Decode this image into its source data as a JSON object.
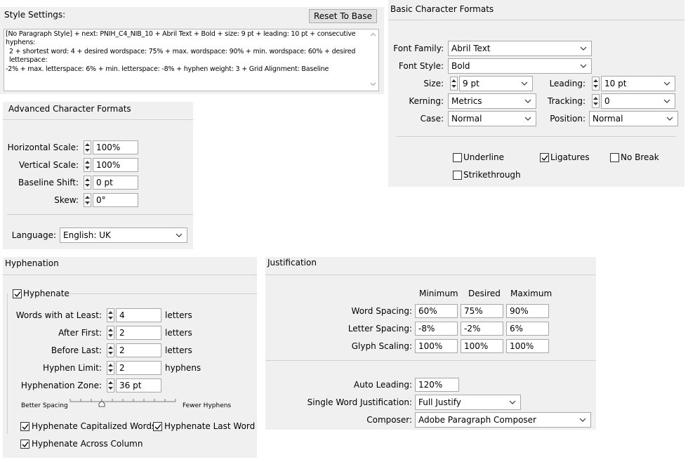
{
  "style_settings": {
    "title": "Style Settings:",
    "reset_button": "Reset To Base",
    "description_lines": [
      "[No Paragraph Style] + next: PNIH_C4_NIB_10 + Abril Text + Bold + size: 9 pt + leading: 10 pt + consecutive hyphens:",
      "2 + shortest word: 4 + desired wordspace: 75% + max. wordspace: 90% + min. wordspace: 60% + desired letterspace:",
      "-2% + max. letterspace: 6% + min. letterspace: -8% + hyphen weight: 3 + Grid Alignment:  Baseline"
    ]
  },
  "basic_character": {
    "title": "Basic Character Formats",
    "font_family": {
      "label": "Font Family:",
      "value": "Abril Text"
    },
    "font_style": {
      "label": "Font Style:",
      "value": "Bold"
    },
    "size": {
      "label": "Size:",
      "value": "9 pt"
    },
    "leading": {
      "label": "Leading:",
      "value": "10 pt"
    },
    "kerning": {
      "label": "Kerning:",
      "value": "Metrics"
    },
    "tracking": {
      "label": "Tracking:",
      "value": "0"
    },
    "case": {
      "label": "Case:",
      "value": "Normal"
    },
    "position": {
      "label": "Position:",
      "value": "Normal"
    },
    "checkboxes": {
      "underline": {
        "label": "Underline",
        "checked": false
      },
      "ligatures": {
        "label": "Ligatures",
        "checked": true
      },
      "no_break": {
        "label": "No Break",
        "checked": false
      },
      "strikethrough": {
        "label": "Strikethrough",
        "checked": false
      }
    }
  },
  "advanced_character": {
    "title": "Advanced Character Formats",
    "horizontal_scale": {
      "label": "Horizontal Scale:",
      "value": "100%"
    },
    "vertical_scale": {
      "label": "Vertical Scale:",
      "value": "100%"
    },
    "baseline_shift": {
      "label": "Baseline Shift:",
      "value": "0 pt"
    },
    "skew": {
      "label": "Skew:",
      "value": "0°"
    },
    "language": {
      "label": "Language:",
      "value": "English: UK"
    }
  },
  "hyphenation": {
    "title": "Hyphenation",
    "hyphenate": {
      "label": "Hyphenate",
      "checked": true
    },
    "words_with_at_least": {
      "label": "Words with at Least:",
      "value": "4",
      "unit": "letters"
    },
    "after_first": {
      "label": "After First:",
      "value": "2",
      "unit": "letters"
    },
    "before_last": {
      "label": "Before Last:",
      "value": "2",
      "unit": "letters"
    },
    "hyphen_limit": {
      "label": "Hyphen Limit:",
      "value": "2",
      "unit": "hyphens"
    },
    "hyphenation_zone": {
      "label": "Hyphenation Zone:",
      "value": "36 pt"
    },
    "slider": {
      "left_label": "Better Spacing",
      "right_label": "Fewer Hyphens",
      "position_fraction": 0.3
    },
    "capitalized": {
      "label": "Hyphenate Capitalized Words",
      "checked": true
    },
    "last_word": {
      "label": "Hyphenate Last Word",
      "checked": true
    },
    "across_column": {
      "label": "Hyphenate Across Column",
      "checked": true
    }
  },
  "justification": {
    "title": "Justification",
    "headers": {
      "minimum": "Minimum",
      "desired": "Desired",
      "maximum": "Maximum"
    },
    "word_spacing": {
      "label": "Word Spacing:",
      "min": "60%",
      "desired": "75%",
      "max": "90%"
    },
    "letter_spacing": {
      "label": "Letter Spacing:",
      "min": "-8%",
      "desired": "-2%",
      "max": "6%"
    },
    "glyph_scaling": {
      "label": "Glyph Scaling:",
      "min": "100%",
      "desired": "100%",
      "max": "100%"
    },
    "auto_leading": {
      "label": "Auto Leading:",
      "value": "120%"
    },
    "single_word": {
      "label": "Single Word Justification:",
      "value": "Full Justify"
    },
    "composer": {
      "label": "Composer:",
      "value": "Adobe Paragraph Composer"
    }
  },
  "icons": {
    "dropdown": "chevron-down-icon",
    "spinner": "spinner-arrows-icon",
    "check": "checkmark-icon"
  }
}
